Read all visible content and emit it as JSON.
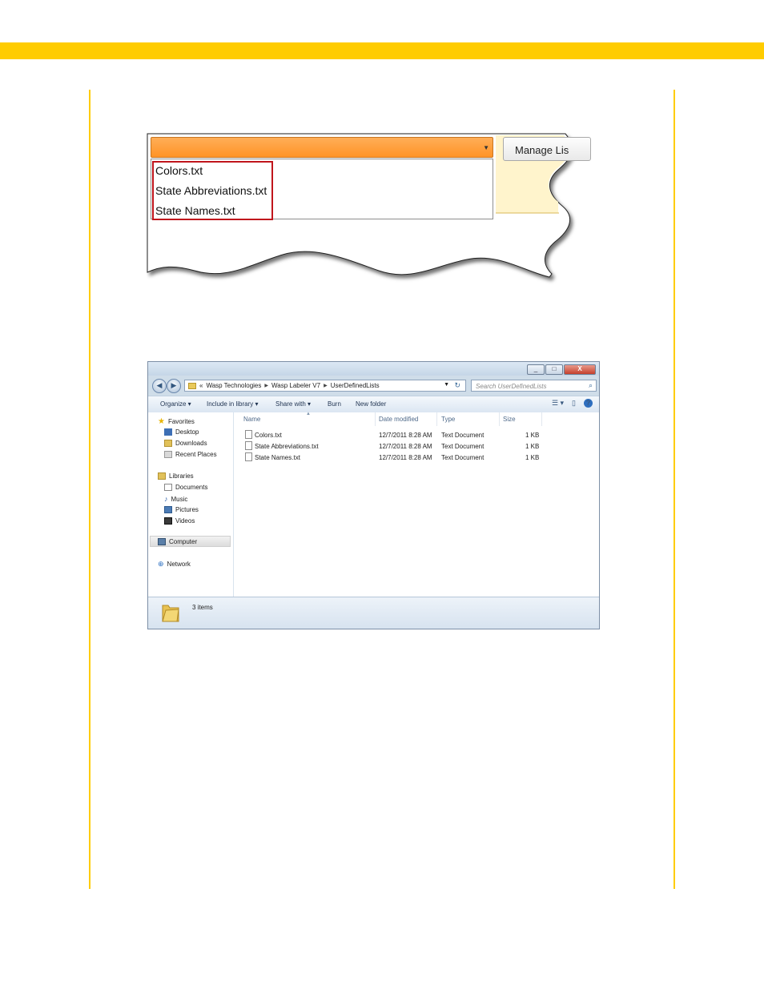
{
  "dropdown_shot": {
    "manage_button_label": "Manage Lis",
    "list_items": [
      "Colors.txt",
      "State Abbreviations.txt",
      "State Names.txt"
    ]
  },
  "explorer": {
    "window_controls": {
      "minimize": "_",
      "maximize": "□",
      "close": "X"
    },
    "address": {
      "prefix": "«",
      "crumbs": [
        "Wasp Technologies",
        "Wasp Labeler V7",
        "UserDefinedLists"
      ]
    },
    "search_placeholder": "Search UserDefinedLists",
    "toolbar": {
      "organize": "Organize ▾",
      "include_in_library": "Include in library ▾",
      "share_with": "Share with ▾",
      "burn": "Burn",
      "new_folder": "New folder"
    },
    "nav": {
      "favorites": "Favorites",
      "desktop": "Desktop",
      "downloads": "Downloads",
      "recent_places": "Recent Places",
      "libraries": "Libraries",
      "documents": "Documents",
      "music": "Music",
      "pictures": "Pictures",
      "videos": "Videos",
      "computer": "Computer",
      "network": "Network"
    },
    "columns": {
      "name": "Name",
      "date_modified": "Date modified",
      "type": "Type",
      "size": "Size"
    },
    "files": [
      {
        "name": "Colors.txt",
        "date": "12/7/2011 8:28 AM",
        "type": "Text Document",
        "size": "1 KB"
      },
      {
        "name": "State Abbreviations.txt",
        "date": "12/7/2011 8:28 AM",
        "type": "Text Document",
        "size": "1 KB"
      },
      {
        "name": "State Names.txt",
        "date": "12/7/2011 8:28 AM",
        "type": "Text Document",
        "size": "1 KB"
      }
    ],
    "status_text": "3 items"
  },
  "colors": {
    "accent": "#ffcc00",
    "combo_orange": "#ff9326",
    "highlight_red": "#c0151c"
  }
}
